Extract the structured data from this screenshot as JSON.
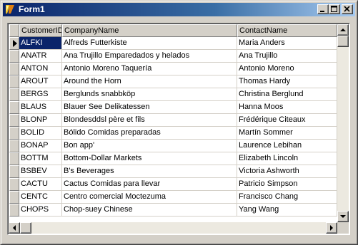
{
  "window": {
    "title": "Form1"
  },
  "grid": {
    "columns": [
      "CustomerID",
      "CompanyName",
      "ContactName"
    ],
    "rows": [
      [
        "ALFKI",
        "Alfreds Futterkiste",
        "Maria Anders"
      ],
      [
        "ANATR",
        "Ana Trujillo Emparedados y helados",
        "Ana Trujillo"
      ],
      [
        "ANTON",
        "Antonio Moreno Taquería",
        "Antonio Moreno"
      ],
      [
        "AROUT",
        "Around the Horn",
        "Thomas Hardy"
      ],
      [
        "BERGS",
        "Berglunds snabbköp",
        "Christina Berglund"
      ],
      [
        "BLAUS",
        "Blauer See Delikatessen",
        "Hanna Moos"
      ],
      [
        "BLONP",
        "Blondesddsl père et fils",
        "Frédérique Citeaux"
      ],
      [
        "BOLID",
        "Bólido Comidas preparadas",
        "Martín Sommer"
      ],
      [
        "BONAP",
        "Bon app'",
        "Laurence Lebihan"
      ],
      [
        "BOTTM",
        "Bottom-Dollar Markets",
        "Elizabeth Lincoln"
      ],
      [
        "BSBEV",
        "B's Beverages",
        "Victoria Ashworth"
      ],
      [
        "CACTU",
        "Cactus Comidas para llevar",
        "Patricio Simpson"
      ],
      [
        "CENTC",
        "Centro comercial Moctezuma",
        "Francisco Chang"
      ],
      [
        "CHOPS",
        "Chop-suey Chinese",
        "Yang Wang"
      ]
    ],
    "selected_row": 0
  },
  "colors": {
    "title_start": "#0a246a",
    "title_end": "#a6caf0",
    "selection": "#0a246a",
    "face": "#d4d0c8"
  },
  "icons": {
    "app": "delphi-icon",
    "minimize": "minimize-icon",
    "maximize": "maximize-icon",
    "close": "close-icon",
    "row_indicator": "row-pointer-icon"
  }
}
